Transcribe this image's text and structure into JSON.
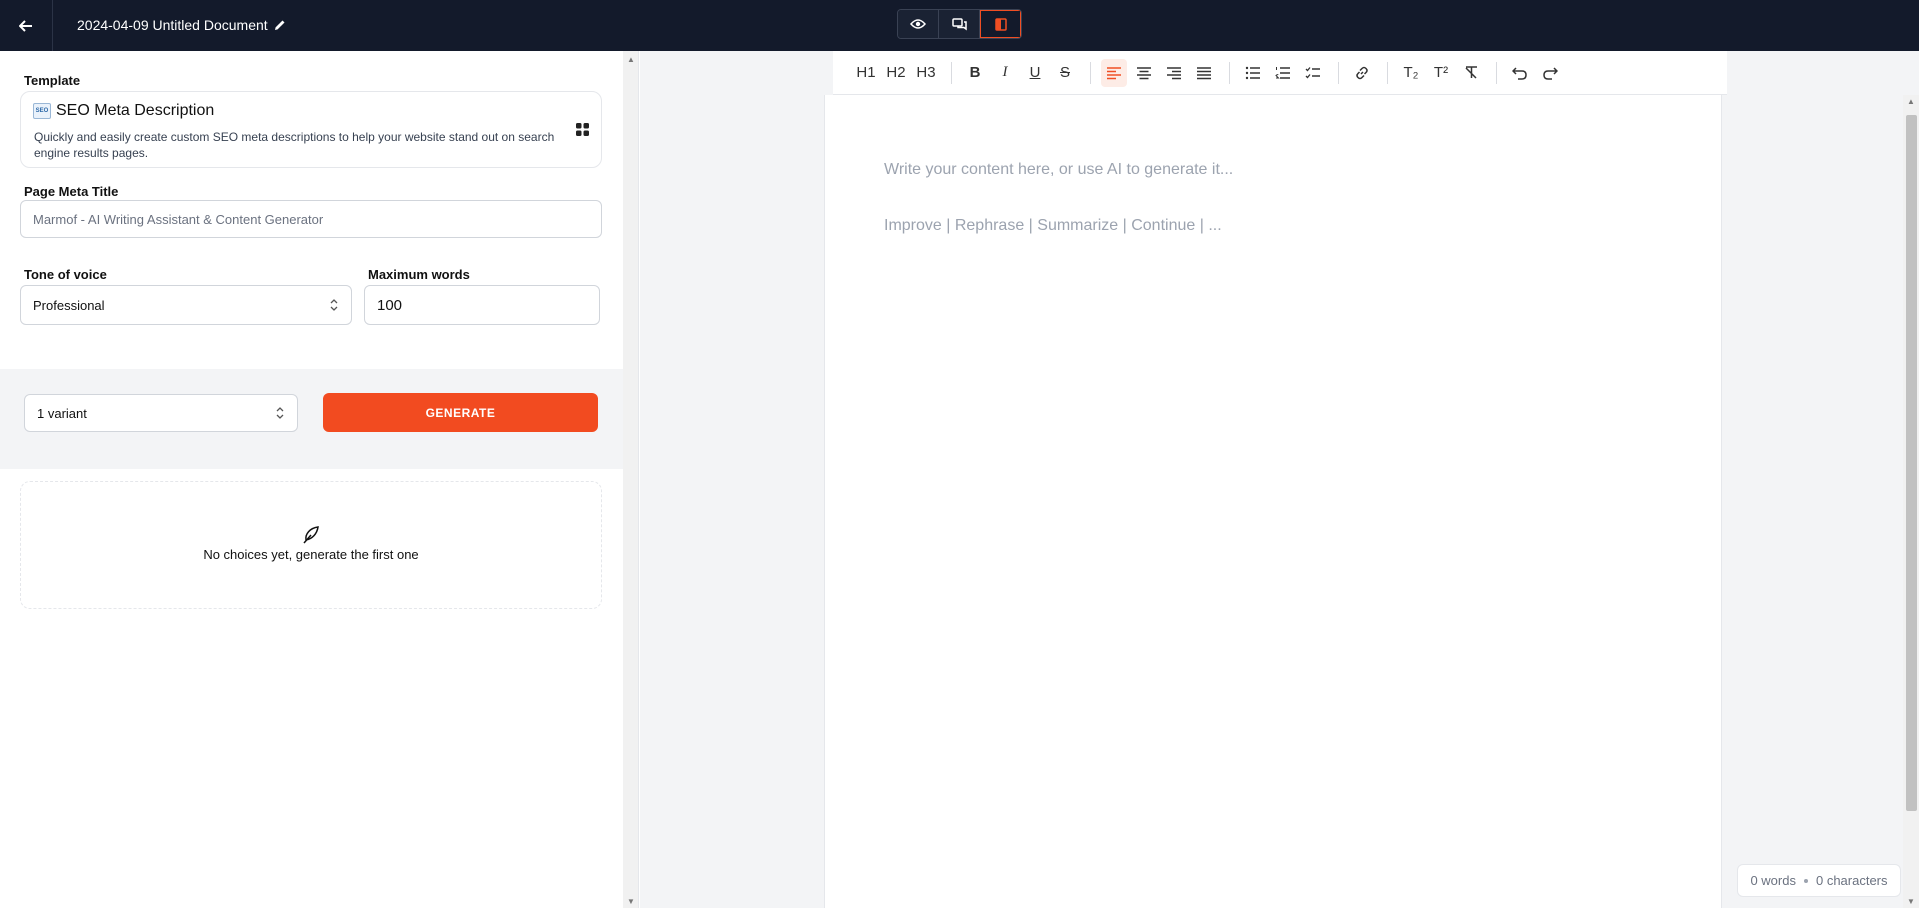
{
  "header": {
    "document_title": "2024-04-09 Untitled Document",
    "icons": [
      "back-arrow-icon",
      "pencil-icon",
      "eye-icon",
      "chat-icon",
      "panel-icon"
    ],
    "accent_color": "#f04e23",
    "background_color": "#131a2b"
  },
  "form": {
    "template_label": "Template",
    "template_name": "SEO Meta Description",
    "template_badge": "SEO",
    "template_description": "Quickly and easily create custom SEO meta descriptions to help your website stand out on search engine results pages.",
    "meta_title_label": "Page Meta Title",
    "meta_title_value": "Marmof - AI Writing Assistant & Content Generator",
    "tone_label": "Tone of voice",
    "tone_value": "Professional",
    "max_words_label": "Maximum words",
    "max_words_value": "100",
    "variants_value": "1 variant",
    "generate_label": "GENERATE",
    "generate_color": "#f24b20",
    "empty_message": "No choices yet, generate the first one"
  },
  "toolbar": {
    "h1": "H1",
    "h2": "H2",
    "h3": "H3",
    "bold": "B",
    "italic": "I",
    "underline": "U",
    "strike": "S",
    "subscript": "T₂",
    "superscript": "T²"
  },
  "editor": {
    "placeholder_line1": "Write your content here, or use AI to generate it...",
    "placeholder_line2": "Improve | Rephrase | Summarize | Continue | ...",
    "word_count": "0 words",
    "char_count": "0 characters"
  }
}
